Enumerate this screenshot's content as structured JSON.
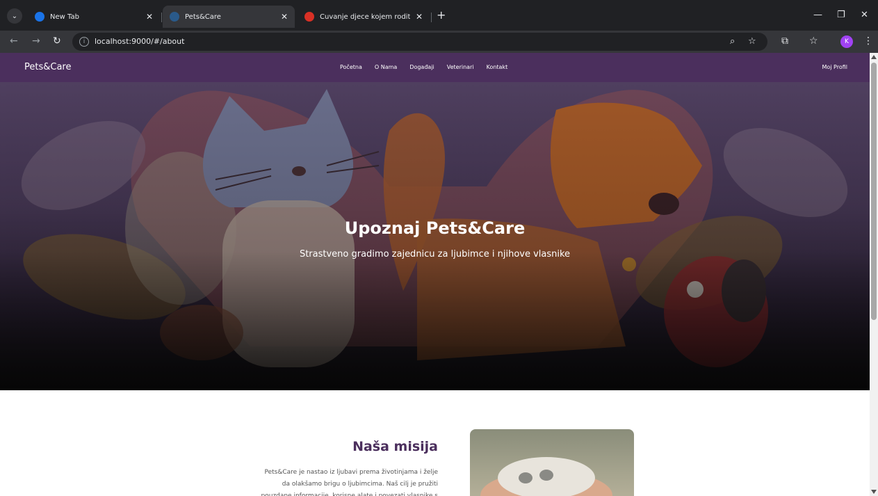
{
  "browser": {
    "tabs": [
      {
        "title": "New Tab",
        "active": false
      },
      {
        "title": "Pets&Care",
        "active": true
      },
      {
        "title": "Čuvanje djece kojem roditelji vj",
        "active": false
      }
    ],
    "url": "localhost:9000/#/about",
    "profile_initial": "K"
  },
  "site": {
    "brand": "Pets&Care",
    "nav": [
      "Početna",
      "O Nama",
      "Događaji",
      "Veterinari",
      "Kontakt"
    ],
    "profile_link": "Moj Profil"
  },
  "hero": {
    "title": "Upoznaj Pets&Care",
    "subtitle": "Strastveno gradimo zajednicu za ljubimce i njihove vlasnike"
  },
  "mission": {
    "title": "Naša misija",
    "lines": [
      "Pets&Care je nastao iz ljubavi prema životinjama i želje",
      "da olakšamo brigu o ljubimcima. Naš cilj je pružiti",
      "pouzdane informacije, korisne alate i povezati vlasnike s"
    ]
  },
  "colors": {
    "nav_bg": "#4b2f5d",
    "accent": "#4b2f5d"
  }
}
